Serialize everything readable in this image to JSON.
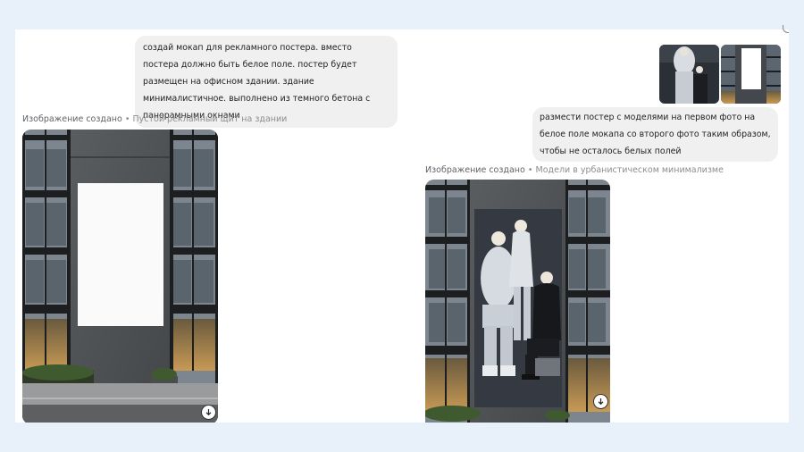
{
  "chat": {
    "user_message_1": "создай мокап для рекламного постера. вместо постера должно быть белое поле. постер будет размещен на офисном здании. здание минималистичное. выполнено из темного бетона с панорамными окнами",
    "user_message_2": "размести постер с моделями на первом фото на белое поле мокапа со второго фото таким образом, чтобы не осталось белых полей",
    "image_1": {
      "status_label": "Изображение создано",
      "separator": "•",
      "title": "Пустой рекламный щит на здании",
      "download_icon": "download-icon"
    },
    "image_2": {
      "status_label": "Изображение создано",
      "separator": "•",
      "title": "Модели в урбанистическом минимализме",
      "download_icon": "download-icon"
    },
    "attachments": [
      {
        "type": "photo",
        "content": "models"
      },
      {
        "type": "photo",
        "content": "mockup"
      }
    ]
  },
  "colors": {
    "page_background": "#e8f0f9",
    "bubble": "#f0f0f0",
    "caption": "#5f6368"
  }
}
